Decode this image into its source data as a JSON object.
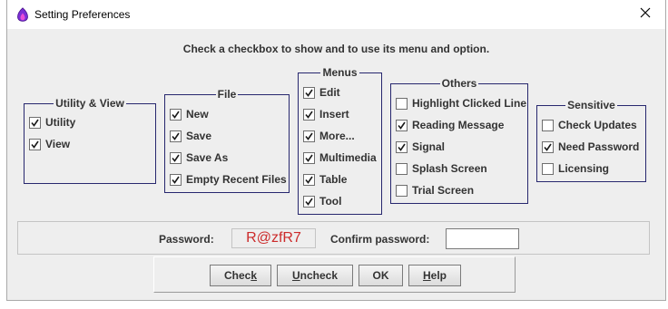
{
  "window": {
    "title": "Setting Preferences",
    "icon": "app-flame-icon",
    "close_icon": "close-icon"
  },
  "instruction": "Check a checkbox to show and to use its menu and option.",
  "groups": [
    {
      "id": "utility-view",
      "legend": "Utility & View",
      "items": [
        {
          "label": "Utility",
          "checked": true
        },
        {
          "label": "View",
          "checked": true
        }
      ]
    },
    {
      "id": "file",
      "legend": "File",
      "items": [
        {
          "label": "New",
          "checked": true
        },
        {
          "label": "Save",
          "checked": true
        },
        {
          "label": "Save As",
          "checked": true
        },
        {
          "label": "Empty Recent Files",
          "checked": true
        }
      ]
    },
    {
      "id": "menus",
      "legend": "Menus",
      "items": [
        {
          "label": "Edit",
          "checked": true
        },
        {
          "label": "Insert",
          "checked": true
        },
        {
          "label": "More...",
          "checked": true
        },
        {
          "label": "Multimedia",
          "checked": true
        },
        {
          "label": "Table",
          "checked": true
        },
        {
          "label": "Tool",
          "checked": true
        }
      ]
    },
    {
      "id": "others",
      "legend": "Others",
      "items": [
        {
          "label": "Highlight Clicked Line",
          "checked": false
        },
        {
          "label": "Reading Message",
          "checked": true
        },
        {
          "label": "Signal",
          "checked": true
        },
        {
          "label": "Splash Screen",
          "checked": false
        },
        {
          "label": "Trial Screen",
          "checked": false
        }
      ]
    },
    {
      "id": "sensitive",
      "legend": "Sensitive",
      "items": [
        {
          "label": "Check Updates",
          "checked": false
        },
        {
          "label": "Need Password",
          "checked": true
        },
        {
          "label": "Licensing",
          "checked": false
        }
      ]
    }
  ],
  "password": {
    "label": "Password:",
    "captcha_value": "R@zfR7",
    "confirm_label": "Confirm password:",
    "confirm_value": ""
  },
  "buttons": {
    "check": {
      "pre": "Chec",
      "mnemonic": "k",
      "post": ""
    },
    "uncheck": {
      "pre": "",
      "mnemonic": "U",
      "post": "ncheck"
    },
    "ok": {
      "pre": "OK",
      "mnemonic": "",
      "post": ""
    },
    "help": {
      "pre": "",
      "mnemonic": "H",
      "post": "elp"
    }
  },
  "colors": {
    "group_border": "#27276e",
    "captcha_text": "#cc2b2b",
    "dialog_background": "#eeeeee"
  }
}
